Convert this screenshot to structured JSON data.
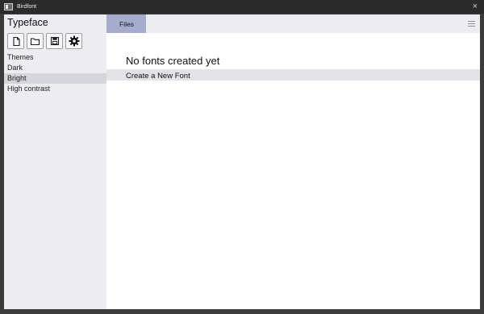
{
  "window": {
    "title": "Birdfont",
    "close_glyph": "×"
  },
  "sidebar": {
    "brand": "Typeface",
    "toolbar": [
      {
        "name": "new-file-icon"
      },
      {
        "name": "folder-icon"
      },
      {
        "name": "save-icon"
      },
      {
        "name": "settings-gear-icon"
      }
    ],
    "themes": [
      {
        "label": "Themes"
      },
      {
        "label": "Dark"
      },
      {
        "label": "Bright",
        "selected": true
      },
      {
        "label": "High contrast"
      }
    ]
  },
  "tabs": [
    {
      "label": "Files",
      "close_glyph": "·",
      "active": true
    }
  ],
  "main": {
    "heading": "No fonts created yet",
    "create_label": "Create a New Font"
  },
  "colors": {
    "sidebar_bg": "#ededf1",
    "active_tab": "#a6acce",
    "selected_row": "#d5d5dc",
    "title_bar": "#2b2b2b"
  }
}
